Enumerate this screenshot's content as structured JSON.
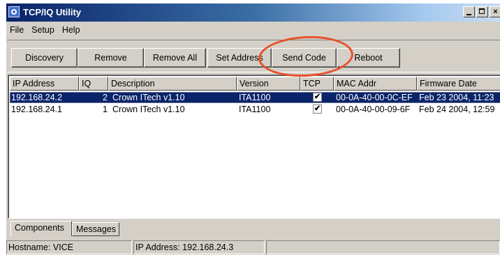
{
  "window": {
    "title": "TCP/IQ Utility"
  },
  "menu": [
    "File",
    "Setup",
    "Help"
  ],
  "toolbar": {
    "discovery": "Discovery",
    "remove": "Remove",
    "remove_all": "Remove All",
    "set_address": "Set Address",
    "send_code": "Send Code",
    "reboot": "Reboot"
  },
  "table": {
    "columns": [
      "IP Address",
      "IQ",
      "Description",
      "Version",
      "TCP",
      "MAC Addr",
      "Firmware Date"
    ],
    "rows": [
      {
        "ip": "192.168.24.2",
        "iq": "2",
        "description": "Crown ITech v1.10",
        "version": "ITA1100",
        "tcp": true,
        "mac": "00-0A-40-00-0C-EF",
        "firmware_date": "Feb 23 2004, 11:23",
        "selected": true
      },
      {
        "ip": "192.168.24.1",
        "iq": "1",
        "description": "Crown ITech v1.10",
        "version": "ITA1100",
        "tcp": true,
        "mac": "00-0A-40-00-09-6F",
        "firmware_date": "Feb 24 2004, 12:59",
        "selected": false
      }
    ]
  },
  "tabs": [
    "Components",
    "Messages"
  ],
  "status": {
    "hostname": "Hostname: VICE",
    "ip_address": "IP Address: 192.168.24.3"
  },
  "colors": {
    "selection": "#0a246a",
    "annotation": "#e8502a",
    "face": "#d4d0c8"
  }
}
